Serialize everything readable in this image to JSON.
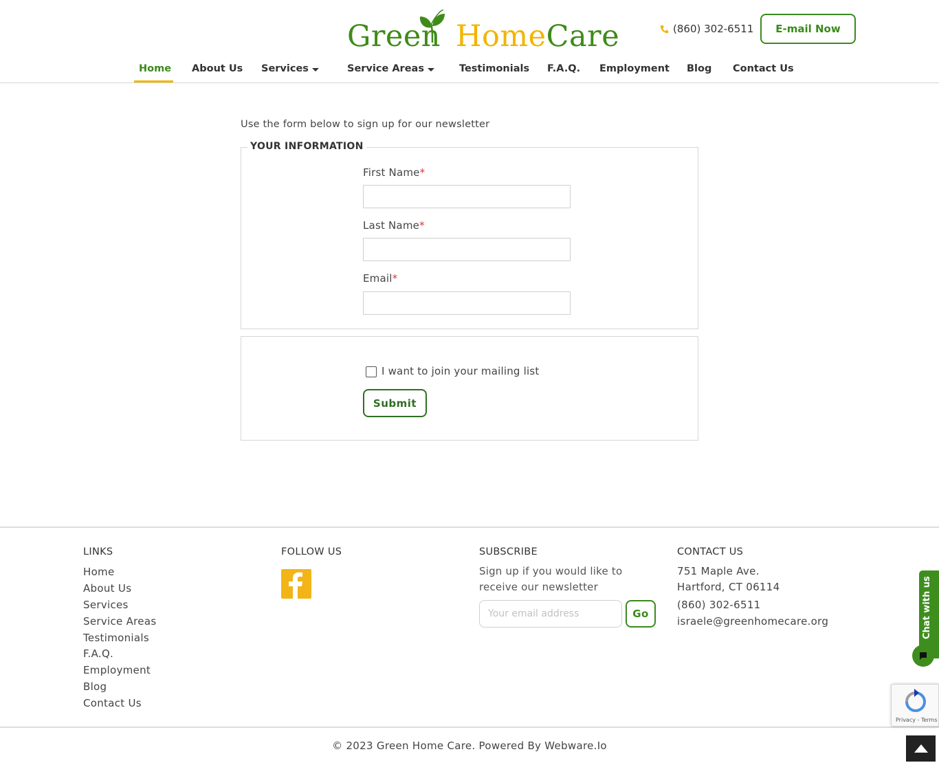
{
  "header": {
    "logo": {
      "part1": "Green",
      "part2": "Home",
      "part3": "Care"
    },
    "phone": "(860) 302-6511",
    "email_button": "E-mail Now"
  },
  "nav": {
    "items": [
      {
        "label": "Home",
        "active": true
      },
      {
        "label": "About Us"
      },
      {
        "label": "Services",
        "dropdown": true
      },
      {
        "label": "Service Areas",
        "dropdown": true
      },
      {
        "label": "Testimonials"
      },
      {
        "label": "F.A.Q."
      },
      {
        "label": "Employment"
      },
      {
        "label": "Blog"
      },
      {
        "label": "Contact Us"
      }
    ]
  },
  "form": {
    "intro": "Use the form below to sign up for our newsletter",
    "legend": "YOUR INFORMATION",
    "fields": [
      {
        "label": "First Name",
        "required_mark": "*",
        "value": ""
      },
      {
        "label": "Last Name",
        "required_mark": "*",
        "value": ""
      },
      {
        "label": "Email",
        "required_mark": "*",
        "value": ""
      }
    ],
    "checkbox_label": "I want to join your mailing list",
    "checkbox_checked": false,
    "submit_label": "Submit"
  },
  "footer": {
    "links_heading": "LINKS",
    "links": [
      "Home",
      "About Us",
      "Services",
      "Service Areas",
      "Testimonials",
      "F.A.Q.",
      "Employment",
      "Blog",
      "Contact Us"
    ],
    "follow_heading": "FOLLOW US",
    "social_icon": "facebook-icon",
    "subscribe_heading": "SUBSCRIBE",
    "subscribe_text": "Sign up if you would like to receive our newsletter",
    "subscribe_placeholder": "Your email address",
    "subscribe_button": "Go",
    "contact_heading": "CONTACT US",
    "address_line1": "751 Maple Ave.",
    "address_line2": "Hartford, CT 06114",
    "phone": "(860) 302-6511",
    "email": "israele@greenhomecare.org",
    "copyright": "© 2023 Green Home Care. Powered By Webware.Io"
  },
  "widgets": {
    "chat_label": "Chat with us",
    "recaptcha_text": "Privacy - Terms"
  },
  "colors": {
    "brand_green": "#3a8a1c",
    "brand_yellow": "#f3b400",
    "required_red": "#d9382f"
  }
}
